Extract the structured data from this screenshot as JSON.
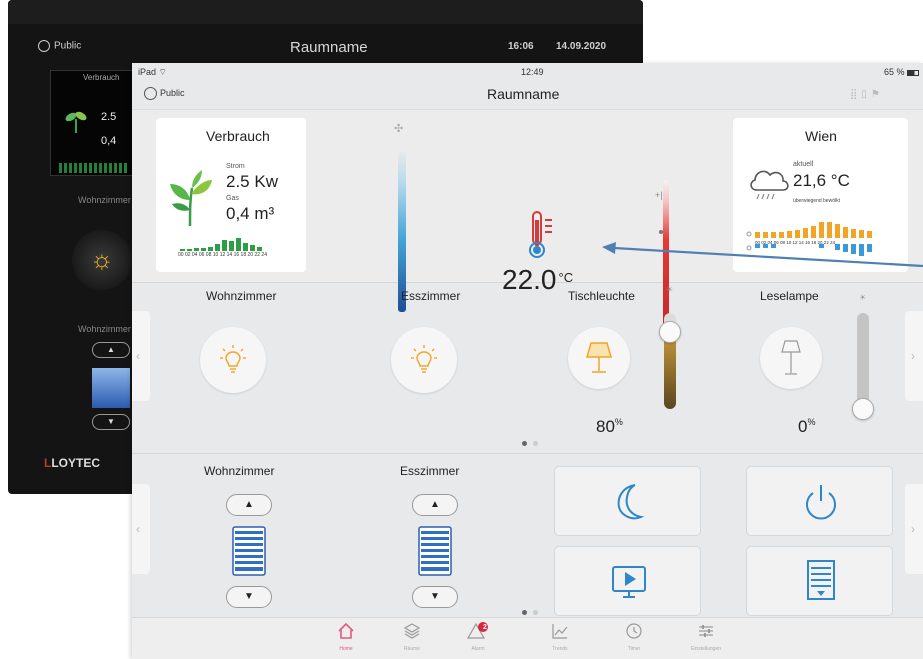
{
  "back_device": {
    "user": "Public",
    "title": "Raumname",
    "time": "16:06",
    "date": "14.09.2020",
    "card_label": "Verbrauch",
    "value1": "2.5",
    "value2": "0,4",
    "room1": "Wohnzimmer",
    "room2": "Wohnzimmer",
    "logo_prefix": "L",
    "logo_rest": "LOYTEC"
  },
  "status_bar": {
    "carrier": "iPad",
    "time": "12:49",
    "battery": "65 %"
  },
  "nav": {
    "user": "Public",
    "title": "Raumname"
  },
  "consumption": {
    "title": "Verbrauch",
    "power_label": "Strom",
    "power_value": "2.5 Kw",
    "gas_label": "Gas",
    "gas_value": "0,4 m³",
    "hours": "00 02 04 06 08 10 12 14 16 18 20 22 24"
  },
  "temperature": {
    "value": "22.0",
    "unit": "°C"
  },
  "weather": {
    "city": "Wien",
    "now_label": "aktuell",
    "temp": "21,6 °C",
    "description": "überwiegend bewölkt",
    "hours": "00 02 04 06 08 10 12 14 16 18 20 22 24"
  },
  "lights": [
    {
      "name": "Wohnzimmer"
    },
    {
      "name": "Esszimmer"
    },
    {
      "name": "Tischleuchte",
      "level": 80,
      "pct_label": "80",
      "pct_unit": "%"
    },
    {
      "name": "Leselampe",
      "level": 0,
      "pct_label": "0",
      "pct_unit": "%"
    }
  ],
  "blinds": [
    {
      "name": "Wohnzimmer"
    },
    {
      "name": "Esszimmer"
    }
  ],
  "tabs": [
    {
      "label": "Home",
      "icon": "home-icon"
    },
    {
      "label": "Räume",
      "icon": "layers-icon"
    },
    {
      "label": "Alarm",
      "icon": "alarm-icon",
      "badge": "2"
    },
    {
      "label": "Trends",
      "icon": "trends-icon"
    },
    {
      "label": "Timer",
      "icon": "timer-icon"
    },
    {
      "label": "Einstellungen",
      "icon": "settings-icon"
    }
  ],
  "colors": {
    "accent_blue": "#2f86c8",
    "active_tab": "#e35a7c",
    "lamp_orange": "#f2a427"
  }
}
